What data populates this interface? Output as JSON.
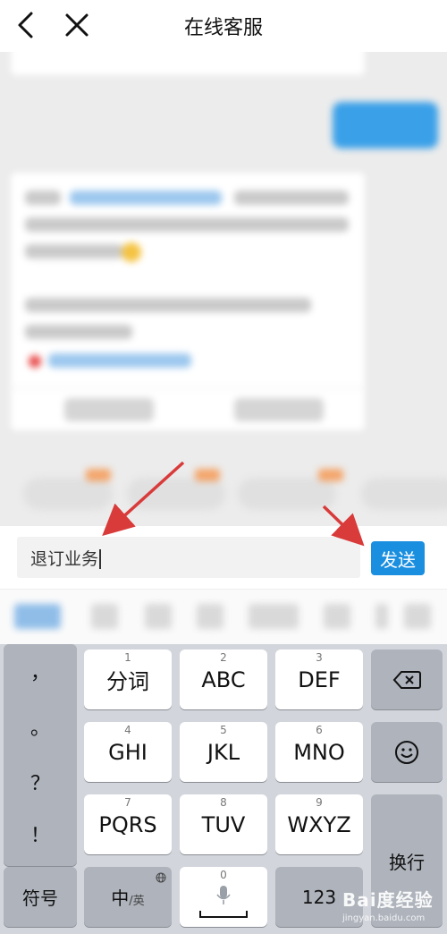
{
  "header": {
    "title": "在线客服",
    "back_icon": "chevron-left-icon",
    "close_icon": "close-icon"
  },
  "input": {
    "value": "退订业务",
    "send_label": "发送"
  },
  "keyboard": {
    "punctuation": [
      "，",
      "。",
      "？",
      "！"
    ],
    "keys": [
      {
        "num": "1",
        "label": "分词"
      },
      {
        "num": "2",
        "label": "ABC"
      },
      {
        "num": "3",
        "label": "DEF"
      },
      {
        "num": "4",
        "label": "GHI"
      },
      {
        "num": "5",
        "label": "JKL"
      },
      {
        "num": "6",
        "label": "MNO"
      },
      {
        "num": "7",
        "label": "PQRS"
      },
      {
        "num": "8",
        "label": "TUV"
      },
      {
        "num": "9",
        "label": "WXYZ"
      }
    ],
    "symbols_label": "符号",
    "lang_main": "中",
    "lang_sub": "/英",
    "space_num": "0",
    "numbers_label": "123",
    "enter_label": "换行",
    "delete_icon": "backspace-icon",
    "emoji_icon": "emoji-icon",
    "mic_icon": "microphone-icon",
    "globe_icon": "globe-icon"
  },
  "watermark": {
    "text": "Bai度经验",
    "sub": "jingyan.baidu.com"
  },
  "colors": {
    "accent": "#1a8fe0",
    "arrow": "#d93a3a"
  }
}
